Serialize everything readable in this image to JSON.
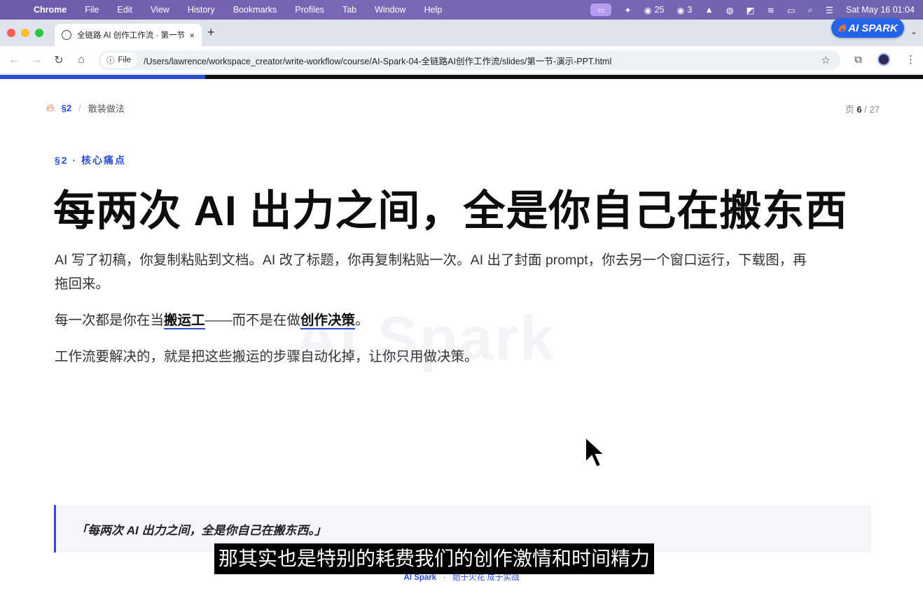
{
  "menubar": {
    "apple_icon": "apple-icon",
    "items": [
      "Chrome",
      "File",
      "Edit",
      "View",
      "History",
      "Bookmarks",
      "Profiles",
      "Tab",
      "Window",
      "Help"
    ],
    "wechat_count": "25",
    "wechat2_count": "3",
    "datetime": "Sat May 16  01:04"
  },
  "browser": {
    "tab_title": "全链路 AI 创作工作流 · 第一节",
    "tab_close": "×",
    "new_tab": "+",
    "badge_text": "AI SPARK",
    "tab_menu": "⌄",
    "file_chip": "File",
    "url": "/Users/lawrence/workspace_creator/write-workflow/course/AI-Spark-04-全链路AI创作工作流/slides/第一节-演示-PPT.html",
    "progress_fraction": 0.222
  },
  "slide": {
    "breadcrumb": {
      "section": "§2",
      "separator": "/",
      "name": "散装做法"
    },
    "pager": {
      "prefix": "页",
      "current": "6",
      "separator": "/",
      "total": "27"
    },
    "watermark": "AI Spark",
    "eyebrow": "§2 · 核心痛点",
    "headline": "每两次 AI 出力之间，全是你自己在搬东西",
    "paragraph1": "AI 写了初稿，你复制粘贴到文档。AI 改了标题，你再复制粘贴一次。AI 出了封面 prompt，你去另一个窗口运行，下载图，再拖回来。",
    "paragraph2": {
      "part1": "每一次都是你在当",
      "highlight1": "搬运工",
      "part2": "——而不是在做",
      "highlight2": "创作决策",
      "part3": "。"
    },
    "paragraph3": "工作流要解决的，就是把这些搬运的步骤自动化掉，让你只用做决策。",
    "quote": "「每两次 AI 出力之间，全是你自己在搬东西。」",
    "subtitle": "那其实也是特别的耗费我们的创作激情和时间精力",
    "footer": {
      "brand": "AI Spark",
      "dot": "·",
      "slogan": "始于火花 成于实战"
    }
  },
  "colors": {
    "accent": "#2a4fd6",
    "menubar": "#7a67b6",
    "flame": "#e85a1f"
  }
}
